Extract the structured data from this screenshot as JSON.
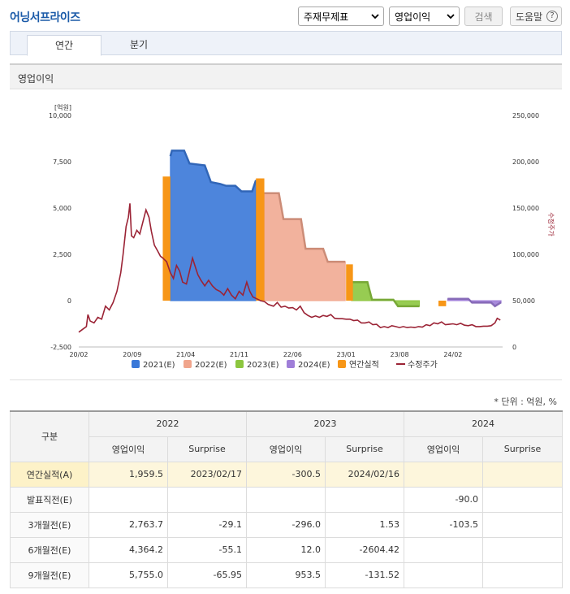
{
  "header": {
    "title": "어닝서프라이즈",
    "select_report": "주재무제표",
    "select_item": "영업이익",
    "search_label": "검색",
    "help_label": "도움말",
    "help_glyph": "?"
  },
  "tabs": [
    {
      "label": "연간",
      "active": true
    },
    {
      "label": "분기",
      "active": false
    }
  ],
  "section_title": "영업이익",
  "chart_data": {
    "type": "area",
    "left_axis_unit": "[억원]",
    "right_axis_label": "수정주가",
    "left_ticks": [
      {
        "v": 10000,
        "label": "10,000"
      },
      {
        "v": 7500,
        "label": "7,500"
      },
      {
        "v": 5000,
        "label": "5,000"
      },
      {
        "v": 2500,
        "label": "2,500"
      },
      {
        "v": 0,
        "label": "0"
      },
      {
        "v": -2500,
        "label": "-2,500"
      }
    ],
    "right_ticks": [
      {
        "v": 250000,
        "label": "250,000"
      },
      {
        "v": 200000,
        "label": "200,000"
      },
      {
        "v": 150000,
        "label": "150,000"
      },
      {
        "v": 100000,
        "label": "100,000"
      },
      {
        "v": 50000,
        "label": "50,000"
      },
      {
        "v": 0,
        "label": "0"
      }
    ],
    "x_ticks": [
      {
        "t": 0,
        "label": "20/02"
      },
      {
        "t": 7,
        "label": "20/09"
      },
      {
        "t": 14,
        "label": "21/04"
      },
      {
        "t": 21,
        "label": "21/11"
      },
      {
        "t": 28,
        "label": "22/06"
      },
      {
        "t": 35,
        "label": "23/01"
      },
      {
        "t": 42,
        "label": "23/08"
      },
      {
        "t": 49,
        "label": "24/02"
      }
    ],
    "ylim": [
      -2500,
      10000
    ],
    "y2lim": [
      0,
      250000
    ],
    "xlim": [
      0,
      55.5
    ],
    "estimate_series": [
      {
        "name": "2021(E)",
        "color": "#3a78d8",
        "points": [
          [
            12,
            7800
          ],
          [
            12.2,
            8100
          ],
          [
            13.8,
            8100
          ],
          [
            14.5,
            7400
          ],
          [
            16.5,
            7300
          ],
          [
            17.3,
            6400
          ],
          [
            18.5,
            6300
          ],
          [
            19.3,
            6200
          ],
          [
            20.5,
            6200
          ],
          [
            21.3,
            5900
          ],
          [
            22.7,
            5900
          ],
          [
            23.2,
            6500
          ]
        ]
      },
      {
        "name": "2022(E)",
        "color": "#f0a58c",
        "points": [
          [
            24.3,
            5800
          ],
          [
            26.2,
            5800
          ],
          [
            26.8,
            4400
          ],
          [
            29.1,
            4400
          ],
          [
            29.7,
            2800
          ],
          [
            32,
            2800
          ],
          [
            32.6,
            2100
          ],
          [
            34.9,
            2100
          ]
        ]
      },
      {
        "name": "2023(E)",
        "color": "#8cc63f",
        "points": [
          [
            35.7,
            1000
          ],
          [
            37.8,
            1000
          ],
          [
            38.4,
            50
          ],
          [
            41.2,
            50
          ],
          [
            41.8,
            -300
          ],
          [
            44.6,
            -300
          ]
        ]
      },
      {
        "name": "2024(E)",
        "color": "#9f7ed8",
        "points": [
          [
            48.3,
            100
          ],
          [
            51,
            100
          ],
          [
            51.5,
            -104
          ],
          [
            54,
            -104
          ],
          [
            54.5,
            -300
          ],
          [
            55.3,
            -90
          ]
        ]
      }
    ],
    "actual_series": {
      "name": "연간실적",
      "color": "#f79617",
      "bars": [
        {
          "x0": 11,
          "x1": 12,
          "value": 6700
        },
        {
          "x0": 23.2,
          "x1": 24.3,
          "value": 6600
        },
        {
          "x0": 35,
          "x1": 35.9,
          "value": 1959.5
        },
        {
          "x0": 47.1,
          "x1": 48.1,
          "value": -300.5
        }
      ]
    },
    "price_series": {
      "name": "수정주가",
      "color": "#9b2335",
      "points": [
        [
          0,
          16000
        ],
        [
          0.5,
          19000
        ],
        [
          1,
          22000
        ],
        [
          1.2,
          35000
        ],
        [
          1.5,
          28000
        ],
        [
          2,
          26000
        ],
        [
          2.5,
          32000
        ],
        [
          3,
          30000
        ],
        [
          3.5,
          44000
        ],
        [
          4,
          40000
        ],
        [
          4.5,
          48000
        ],
        [
          5,
          60000
        ],
        [
          5.5,
          80000
        ],
        [
          5.8,
          100000
        ],
        [
          6.2,
          130000
        ],
        [
          6.5,
          140000
        ],
        [
          6.7,
          155000
        ],
        [
          6.9,
          120000
        ],
        [
          7.2,
          118000
        ],
        [
          7.6,
          126000
        ],
        [
          8,
          122000
        ],
        [
          8.4,
          135000
        ],
        [
          8.8,
          148000
        ],
        [
          9.2,
          140000
        ],
        [
          9.5,
          125000
        ],
        [
          9.9,
          110000
        ],
        [
          10.3,
          104000
        ],
        [
          10.7,
          98000
        ],
        [
          11,
          96000
        ],
        [
          11.5,
          92000
        ],
        [
          12,
          80000
        ],
        [
          12.4,
          74000
        ],
        [
          12.8,
          88000
        ],
        [
          13.2,
          82000
        ],
        [
          13.6,
          70000
        ],
        [
          14.1,
          68000
        ],
        [
          14.5,
          82000
        ],
        [
          14.9,
          96000
        ],
        [
          15.2,
          88000
        ],
        [
          15.6,
          78000
        ],
        [
          16,
          72000
        ],
        [
          16.5,
          66000
        ],
        [
          17,
          72000
        ],
        [
          17.5,
          66000
        ],
        [
          18,
          62000
        ],
        [
          18.5,
          60000
        ],
        [
          19,
          56000
        ],
        [
          19.5,
          63000
        ],
        [
          20,
          56000
        ],
        [
          20.5,
          52000
        ],
        [
          21,
          60000
        ],
        [
          21.5,
          56000
        ],
        [
          22,
          70000
        ],
        [
          22.4,
          60000
        ],
        [
          22.8,
          54000
        ],
        [
          23.3,
          52000
        ],
        [
          23.8,
          50000
        ],
        [
          24.3,
          49000
        ],
        [
          24.8,
          46000
        ],
        [
          25.5,
          44000
        ],
        [
          26,
          48000
        ],
        [
          26.5,
          43000
        ],
        [
          27,
          44000
        ],
        [
          27.5,
          42000
        ],
        [
          28,
          42500
        ],
        [
          28.5,
          40000
        ],
        [
          29,
          44000
        ],
        [
          29.5,
          37000
        ],
        [
          30,
          34000
        ],
        [
          30.5,
          32000
        ],
        [
          31,
          33500
        ],
        [
          31.5,
          32000
        ],
        [
          32,
          34000
        ],
        [
          32.5,
          33000
        ],
        [
          33,
          35000
        ],
        [
          33.5,
          31000
        ],
        [
          34,
          30500
        ],
        [
          34.5,
          30500
        ],
        [
          35,
          30000
        ],
        [
          35.5,
          30000
        ],
        [
          36,
          28500
        ],
        [
          36.5,
          29000
        ],
        [
          37,
          26000
        ],
        [
          37.5,
          26000
        ],
        [
          38,
          27000
        ],
        [
          38.5,
          24000
        ],
        [
          39,
          24500
        ],
        [
          39.5,
          21000
        ],
        [
          40,
          22000
        ],
        [
          40.5,
          21000
        ],
        [
          41,
          23000
        ],
        [
          41.5,
          22000
        ],
        [
          42,
          21000
        ],
        [
          42.5,
          22000
        ],
        [
          43,
          21000
        ],
        [
          43.5,
          21500
        ],
        [
          44,
          21000
        ],
        [
          44.5,
          22000
        ],
        [
          45,
          21500
        ],
        [
          45.5,
          24000
        ],
        [
          46,
          23000
        ],
        [
          46.5,
          26000
        ],
        [
          47,
          25000
        ],
        [
          47.5,
          27000
        ],
        [
          48,
          24000
        ],
        [
          48.5,
          24500
        ],
        [
          49,
          25000
        ],
        [
          49.5,
          24000
        ],
        [
          50,
          25500
        ],
        [
          50.5,
          23500
        ],
        [
          51,
          23000
        ],
        [
          51.5,
          24000
        ],
        [
          52,
          22000
        ],
        [
          52.5,
          22000
        ],
        [
          53,
          22500
        ],
        [
          53.5,
          22500
        ],
        [
          54,
          23000
        ],
        [
          54.5,
          26000
        ],
        [
          54.8,
          31000
        ],
        [
          55.2,
          29000
        ]
      ]
    },
    "legend": [
      "2021(E)",
      "2022(E)",
      "2023(E)",
      "2024(E)",
      "연간실적",
      "수정주가"
    ],
    "legend_position": "bottom"
  },
  "table": {
    "unit_note": "* 단위 : 억원, %",
    "category_header": "구분",
    "years": [
      "2022",
      "2023",
      "2024"
    ],
    "sub_headers": [
      "영업이익",
      "Surprise",
      "영업이익",
      "Surprise",
      "영업이익",
      "Surprise"
    ],
    "rows": [
      {
        "label": "연간실적(A)",
        "highlight": true,
        "cells": [
          "1,959.5",
          "2023/02/17",
          "-300.5",
          "2024/02/16",
          "",
          ""
        ]
      },
      {
        "label": "발표직전(E)",
        "highlight": false,
        "cells": [
          "",
          "",
          "",
          "",
          "-90.0",
          ""
        ]
      },
      {
        "label": "3개월전(E)",
        "highlight": false,
        "cells": [
          "2,763.7",
          "-29.1",
          "-296.0",
          "1.53",
          "-103.5",
          ""
        ]
      },
      {
        "label": "6개월전(E)",
        "highlight": false,
        "cells": [
          "4,364.2",
          "-55.1",
          "12.0",
          "-2604.42",
          "",
          ""
        ]
      },
      {
        "label": "9개월전(E)",
        "highlight": false,
        "cells": [
          "5,755.0",
          "-65.95",
          "953.5",
          "-131.52",
          "",
          ""
        ]
      }
    ]
  }
}
